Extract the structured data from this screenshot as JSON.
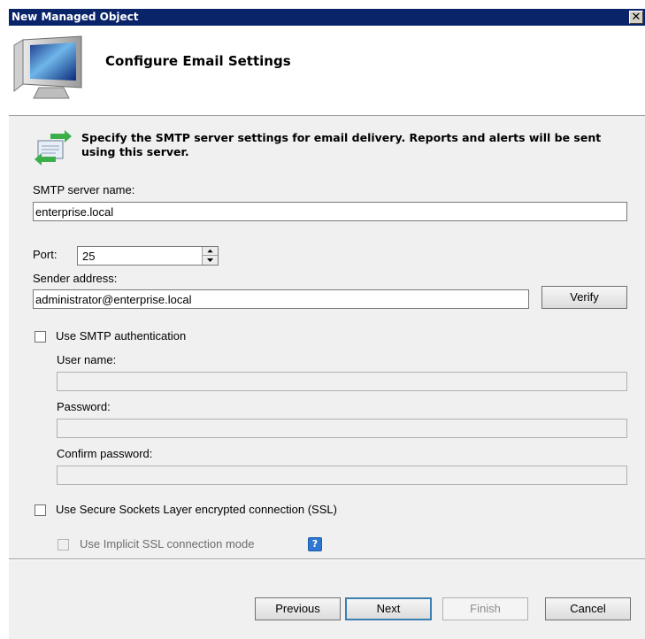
{
  "window": {
    "title": "New Managed Object",
    "close_glyph": "✕"
  },
  "header": {
    "title": "Configure Email Settings",
    "icon": "computer-monitor-icon"
  },
  "info": {
    "icon": "email-server-icon",
    "text": "Specify the SMTP server settings for email delivery. Reports and alerts will be sent using this server."
  },
  "smtp": {
    "label": "SMTP server name:",
    "value": "enterprise.local"
  },
  "port": {
    "label": "Port:",
    "value": "25"
  },
  "sender": {
    "label": "Sender address:",
    "value": "administrator@enterprise.local",
    "verify_label": "Verify"
  },
  "auth": {
    "checkbox_label": "Use SMTP authentication",
    "checked": false,
    "username_label": "User name:",
    "username_value": "",
    "password_label": "Password:",
    "password_value": "",
    "confirm_label": "Confirm password:",
    "confirm_value": ""
  },
  "ssl": {
    "checkbox_label": "Use Secure Sockets Layer encrypted connection (SSL)",
    "checked": false,
    "implicit_label": "Use Implicit SSL connection mode",
    "help_glyph": "?"
  },
  "footer": {
    "previous": "Previous",
    "next": "Next",
    "finish": "Finish",
    "cancel": "Cancel"
  },
  "colors": {
    "titlebar": "#0a246a",
    "dialog_bg": "#f0f0f0",
    "default_button_border": "#3c7fb1",
    "help_icon": "#2e78d2"
  }
}
